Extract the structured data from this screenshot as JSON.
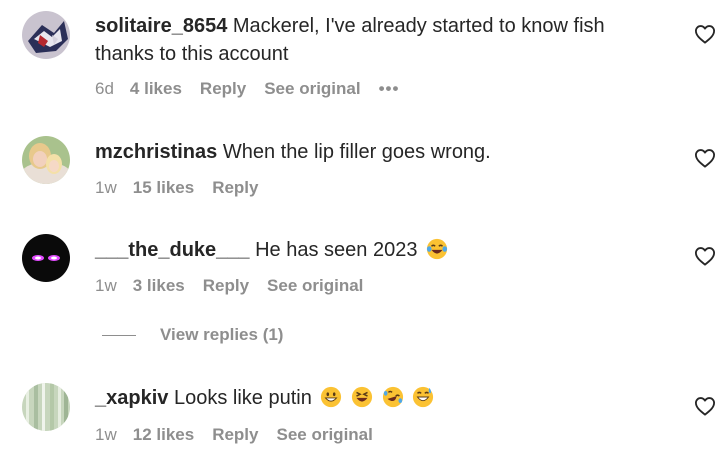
{
  "comments": [
    {
      "username": "solitaire_8654",
      "text": "Mackerel, I've already started to know fish thanks to this account",
      "time": "6d",
      "likes": "4 likes",
      "reply": "Reply",
      "see_original": "See original",
      "more": "•••"
    },
    {
      "username": "mzchristinas",
      "text": "When the lip filler goes wrong.",
      "time": "1w",
      "likes": "15 likes",
      "reply": "Reply"
    },
    {
      "username": "___the_duke___",
      "text": "He has seen 2023",
      "time": "1w",
      "likes": "3 likes",
      "reply": "Reply",
      "see_original": "See original",
      "view_replies": "View replies (1)"
    },
    {
      "username": "_xapkiv",
      "text": "Looks like putin",
      "time": "1w",
      "likes": "12 likes",
      "reply": "Reply",
      "see_original": "See original"
    }
  ],
  "icons": {
    "like": "heart-outline-icon",
    "emoji_laugh": "face-with-tears-of-joy",
    "emoji_grin": "grinning-face",
    "emoji_squint": "grinning-squinting-face",
    "emoji_rofl": "rolling-on-floor-laughing",
    "emoji_sweat": "grinning-face-with-sweat"
  },
  "colors": {
    "text": "#262626",
    "secondary": "#8e8e8e",
    "background": "#ffffff"
  }
}
